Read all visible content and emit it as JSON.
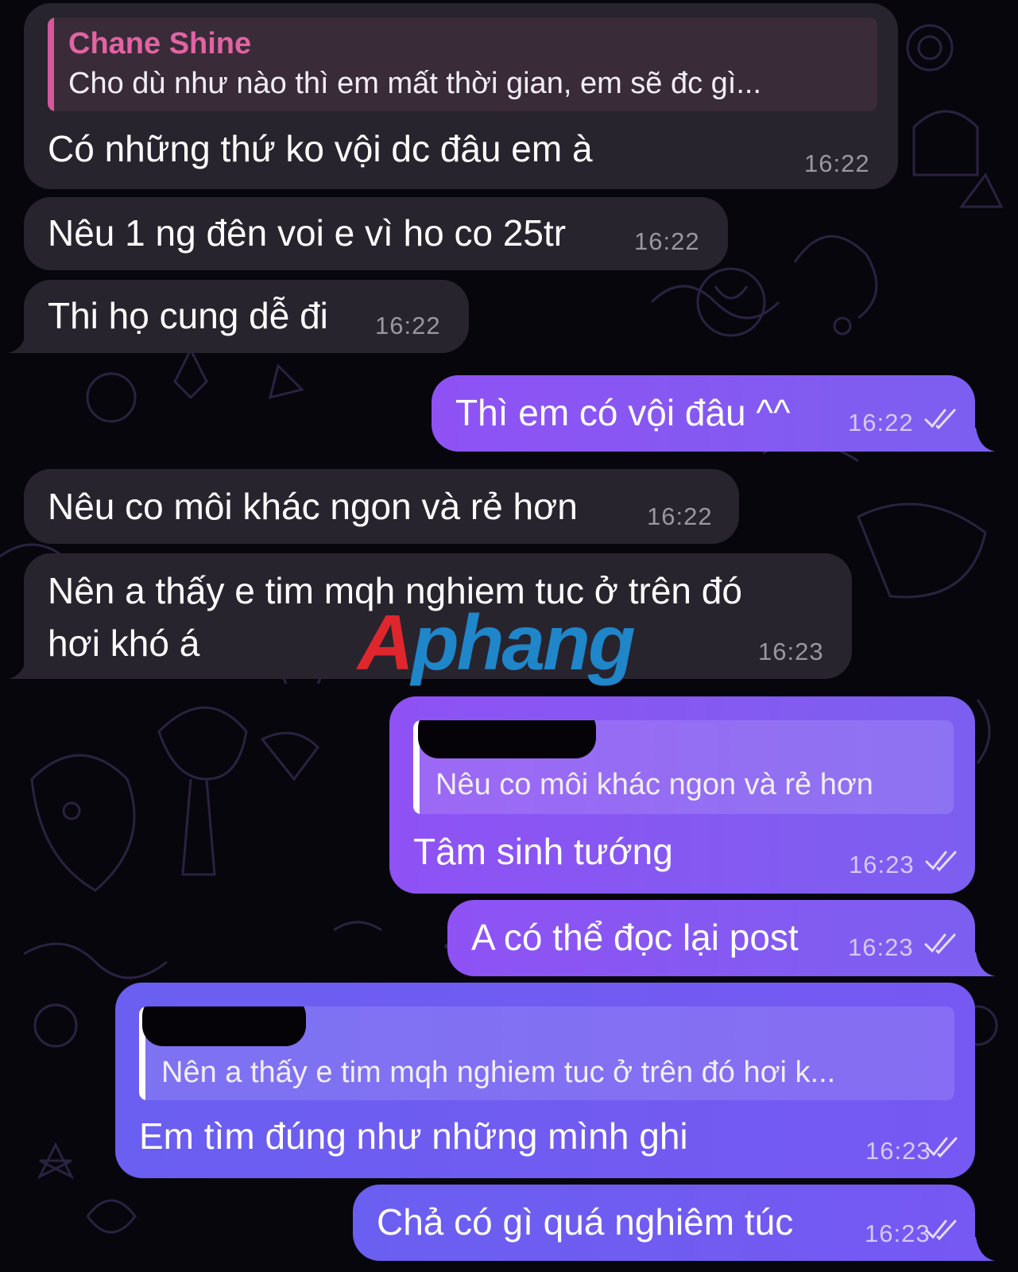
{
  "watermark": {
    "first": "A",
    "rest": "phang"
  },
  "colors": {
    "incoming_bubble": "#27242e",
    "outgoing_bubble": "#8f52f4",
    "quote_author": "#e164a4",
    "background": "#07060c"
  },
  "messages": [
    {
      "direction": "in",
      "reply_to": {
        "author": "Chane Shine",
        "text": "Cho dù như nào thì em mất thời gian, em sẽ đc gì..."
      },
      "text": "Có những thứ ko vội dc đâu em à",
      "time": "16:22"
    },
    {
      "direction": "in",
      "text": "Nêu 1 ng đên voi e vì ho co 25tr",
      "time": "16:22"
    },
    {
      "direction": "in",
      "text": "Thi họ cung dễ đi",
      "time": "16:22"
    },
    {
      "direction": "out",
      "text": "Thì em có vội đâu ^^",
      "time": "16:22",
      "status_icon": "double-check-icon"
    },
    {
      "direction": "in",
      "text": "Nêu co môi khác ngon và rẻ hơn",
      "time": "16:22"
    },
    {
      "direction": "in",
      "text_lines": [
        "Nên a thấy e tim mqh nghiem tuc ở trên đó",
        "hơi khó á"
      ],
      "time": "16:23"
    },
    {
      "direction": "out",
      "reply_to": {
        "author_redacted": true,
        "text": "Nêu co môi khác ngon và rẻ hơn"
      },
      "text": "Tâm sinh tướng",
      "time": "16:23",
      "status_icon": "double-check-icon"
    },
    {
      "direction": "out",
      "text": "A có thể đọc lại post",
      "time": "16:23",
      "status_icon": "double-check-icon"
    },
    {
      "direction": "out",
      "reply_to": {
        "author_redacted": true,
        "text": "Nên a thấy e tim mqh nghiem tuc ở trên đó hơi k..."
      },
      "text": "Em tìm đúng như những mình ghi",
      "time": "16:23",
      "status_icon": "double-check-icon"
    },
    {
      "direction": "out",
      "text": "Chả có gì quá nghiêm túc",
      "time": "16:23",
      "status_icon": "double-check-icon"
    }
  ]
}
